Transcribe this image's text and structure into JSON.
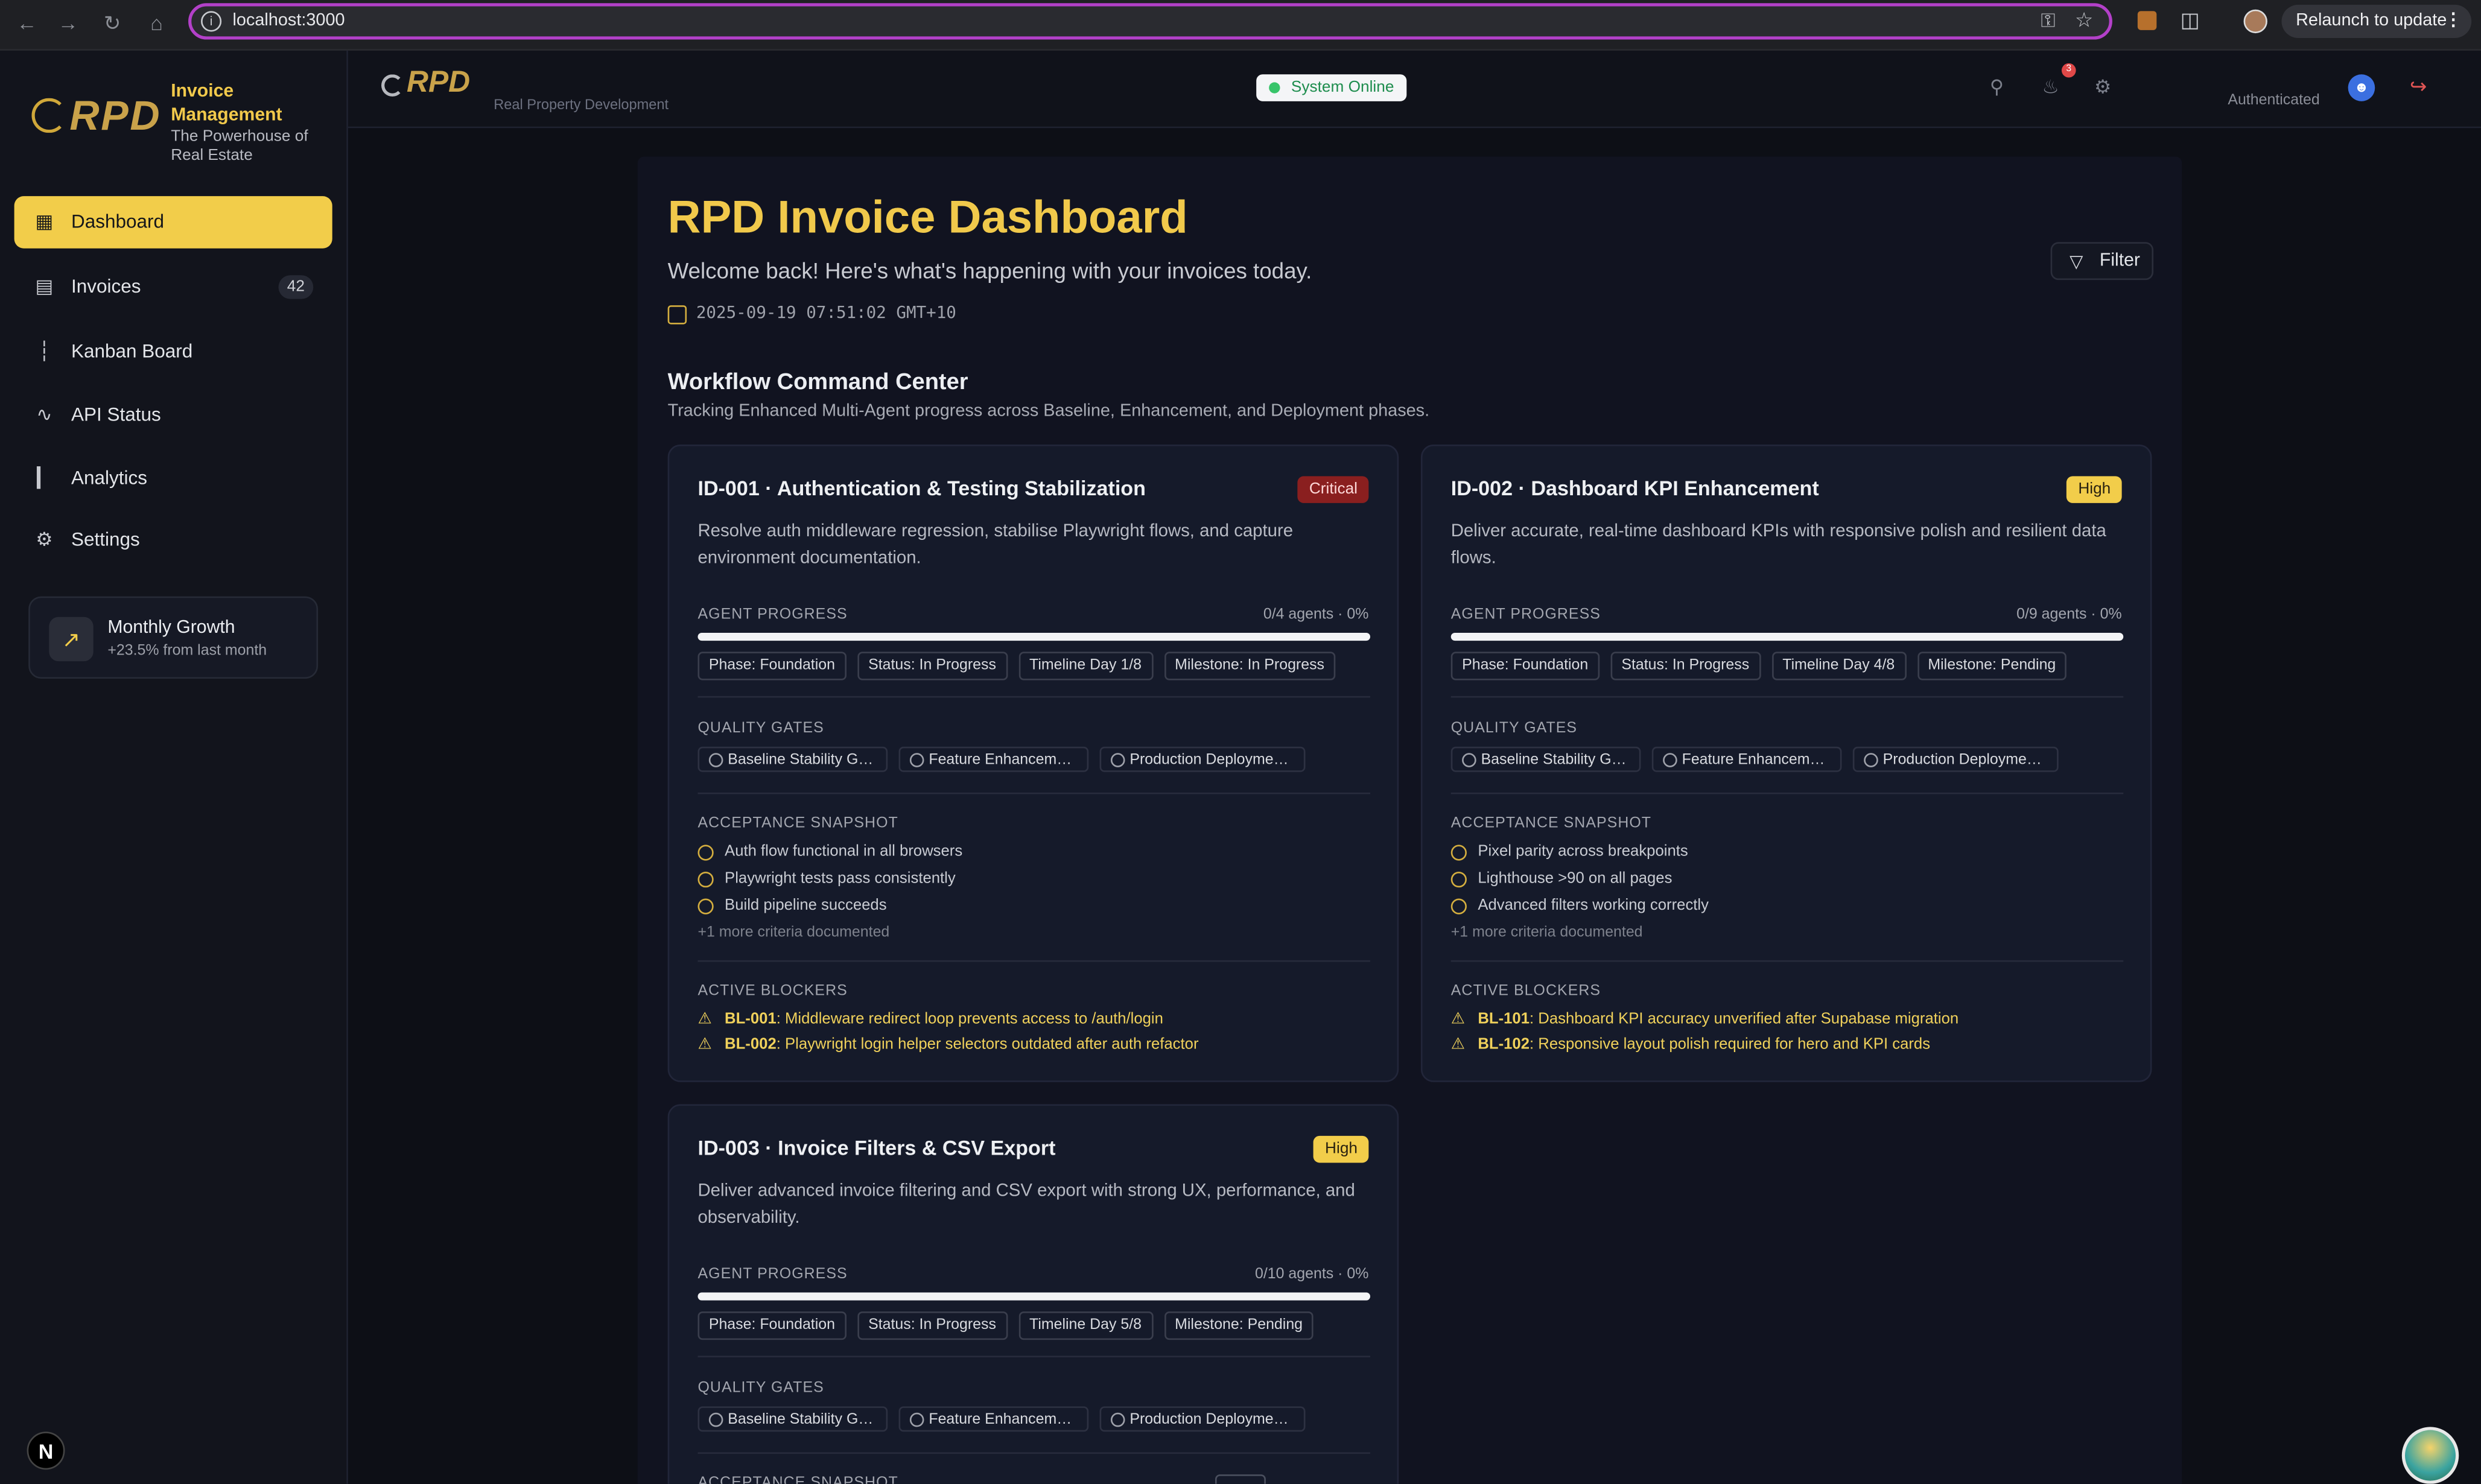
{
  "browser": {
    "url": "localhost:3000",
    "relaunch_label": "Relaunch to update"
  },
  "sidebar": {
    "logo_text": "RPD",
    "brand_title": "Invoice Management",
    "brand_subtitle": "The Powerhouse of Real Estate",
    "items": [
      {
        "label": "Dashboard",
        "icon": "grid-icon",
        "active": true
      },
      {
        "label": "Invoices",
        "icon": "file-icon",
        "badge": "42"
      },
      {
        "label": "Kanban Board",
        "icon": "kanban-icon"
      },
      {
        "label": "API Status",
        "icon": "activity-icon"
      },
      {
        "label": "Analytics",
        "icon": "bar-chart-icon"
      },
      {
        "label": "Settings",
        "icon": "gear-icon"
      }
    ],
    "growth": {
      "title": "Monthly Growth",
      "subtitle": "+23.5% from last month"
    }
  },
  "header": {
    "logo_text": "RPD",
    "subtitle": "Real Property Development",
    "status": "System Online",
    "notification_count": "3",
    "auth_label": "Authenticated"
  },
  "page": {
    "title": "RPD Invoice Dashboard",
    "welcome": "Welcome back! Here's what's happening with your invoices today.",
    "timestamp": "2025-09-19 07:51:02 GMT+10",
    "filter_label": "Filter",
    "section_title": "Workflow Command Center",
    "section_subtitle": "Tracking Enhanced Multi-Agent progress across Baseline, Enhancement, and Deployment phases."
  },
  "labels": {
    "agent_progress": "AGENT PROGRESS",
    "quality_gates": "QUALITY GATES",
    "acceptance": "ACCEPTANCE SNAPSHOT",
    "blockers": "ACTIVE BLOCKERS"
  },
  "cards": [
    {
      "title": "ID-001 · Authentication & Testing Stabilization",
      "priority": "Critical",
      "description": "Resolve auth middleware regression, stabilise Playwright flows, and capture environment documentation.",
      "progress_meta": "0/4 agents · 0%",
      "progress": 0,
      "chips": [
        "Phase: Foundation",
        "Status: In Progress",
        "Timeline Day 1/8",
        "Milestone: In Progress"
      ],
      "gates": [
        "Baseline Stability Gate",
        "Feature Enhancement ...",
        "Production Deployment..."
      ],
      "criteria": [
        "Auth flow functional in all browsers",
        "Playwright tests pass consistently",
        "Build pipeline succeeds"
      ],
      "more": "+1 more criteria documented",
      "blockers": [
        {
          "id": "BL-001",
          "text": ": Middleware redirect loop prevents access to /auth/login"
        },
        {
          "id": "BL-002",
          "text": ": Playwright login helper selectors outdated after auth refactor"
        }
      ]
    },
    {
      "title": "ID-002 · Dashboard KPI Enhancement",
      "priority": "High",
      "description": "Deliver accurate, real-time dashboard KPIs with responsive polish and resilient data flows.",
      "progress_meta": "0/9 agents · 0%",
      "progress": 0,
      "chips": [
        "Phase: Foundation",
        "Status: In Progress",
        "Timeline Day 4/8",
        "Milestone: Pending"
      ],
      "gates": [
        "Baseline Stability Gate",
        "Feature Enhancement ...",
        "Production Deployment..."
      ],
      "criteria": [
        "Pixel parity across breakpoints",
        "Lighthouse >90 on all pages",
        "Advanced filters working correctly"
      ],
      "more": "+1 more criteria documented",
      "blockers": [
        {
          "id": "BL-101",
          "text": ": Dashboard KPI accuracy unverified after Supabase migration"
        },
        {
          "id": "BL-102",
          "text": ": Responsive layout polish required for hero and KPI cards"
        }
      ]
    },
    {
      "title": "ID-003 · Invoice Filters & CSV Export",
      "priority": "High",
      "description": "Deliver advanced invoice filtering and CSV export with strong UX, performance, and observability.",
      "progress_meta": "0/10 agents · 0%",
      "progress": 0,
      "chips": [
        "Phase: Foundation",
        "Status: In Progress",
        "Timeline Day 5/8",
        "Milestone: Pending"
      ],
      "gates": [
        "Baseline Stability Gate",
        "Feature Enhancement ...",
        "Production Deployment..."
      ],
      "criteria": [],
      "more": "",
      "blockers": []
    }
  ],
  "colors": {
    "accent": "#f2cd4a",
    "critical": "#8a1f1f",
    "online": "#37c46a"
  }
}
